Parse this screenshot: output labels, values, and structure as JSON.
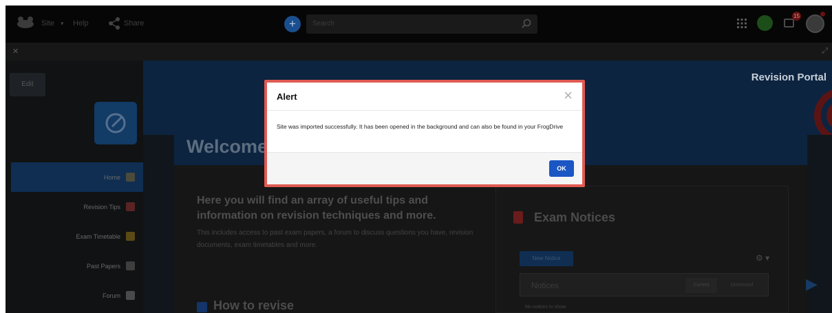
{
  "topbar": {
    "site_label": "Site",
    "help_label": "Help",
    "share_label": "Share",
    "search_placeholder": "Search",
    "notification_count": "15"
  },
  "toolbar": {
    "edit_label": "Edit"
  },
  "banner": {
    "title": "Revision Portal"
  },
  "sidebar": {
    "items": [
      {
        "label": "Home"
      },
      {
        "label": "Revision Tips"
      },
      {
        "label": "Exam Timetable"
      },
      {
        "label": "Past Papers"
      },
      {
        "label": "Forum"
      }
    ]
  },
  "content": {
    "welcome": "Welcome",
    "intro_heading": "Here you will find an array of useful tips and information on revision techniques and more.",
    "intro_text": "This includes access to past exam papers, a forum to discuss questions you have, revision documents, exam timetables and more.",
    "howto_heading": "How to revise"
  },
  "exam_notices": {
    "title": "Exam Notices",
    "new_notice_label": "New Notice",
    "notices_placeholder": "Notices",
    "tab_current": "Current",
    "tab_dismissed": "Dismissed",
    "empty_text": "No notices to show"
  },
  "modal": {
    "title": "Alert",
    "close_glyph": "×",
    "body": "Site was imported successfully. It has been opened in the background and can also be found in your FrogDrive",
    "ok_label": "OK"
  },
  "colors": {
    "modal_border": "#e05a52",
    "ok_button": "#1a56c4",
    "brand_blue": "#0d2440"
  }
}
